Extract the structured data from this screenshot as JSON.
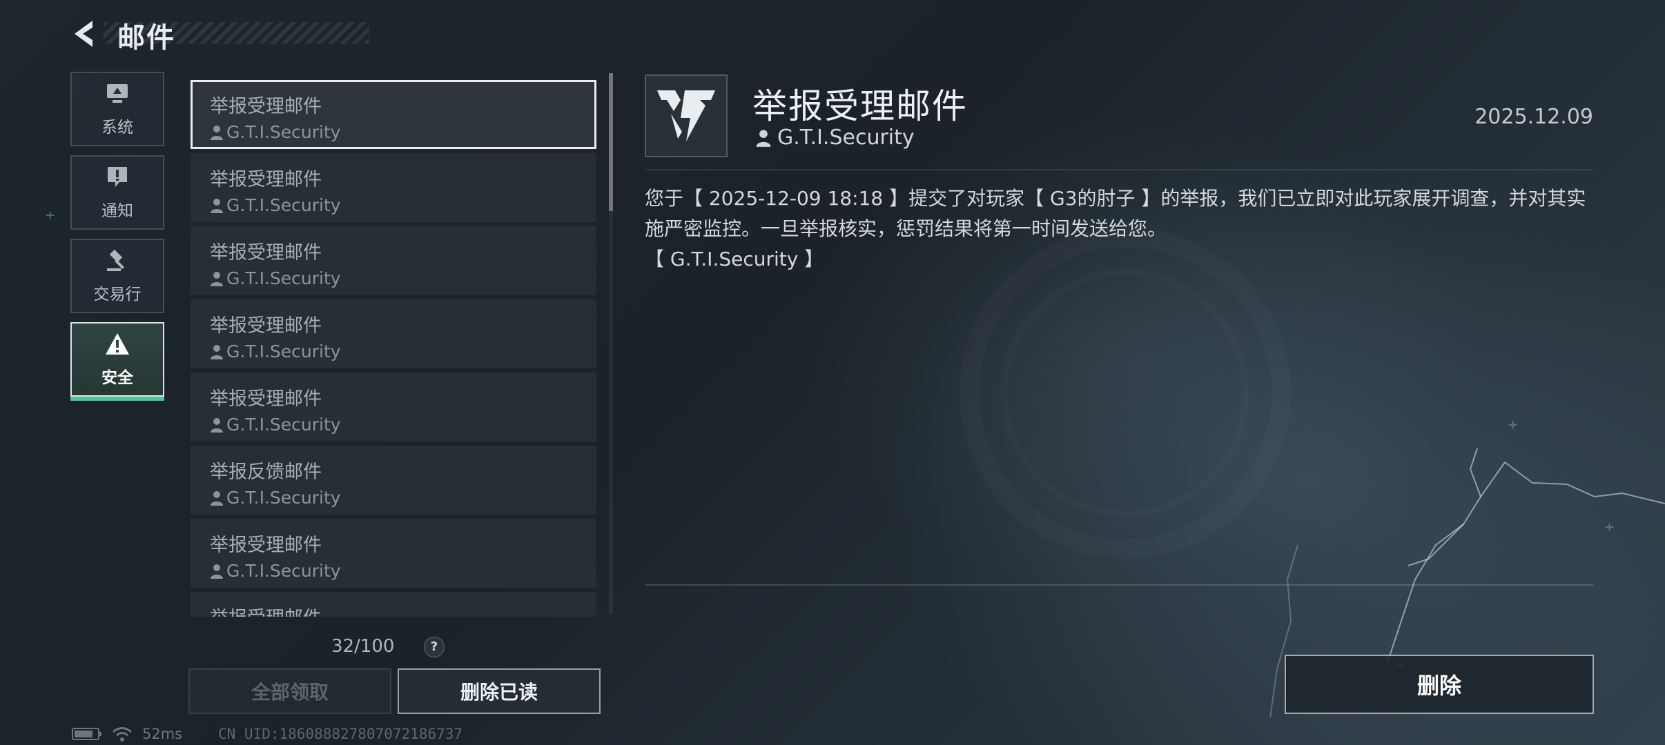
{
  "header": {
    "title": "邮件"
  },
  "categories": [
    {
      "label": "系统",
      "icon": "monitor-icon"
    },
    {
      "label": "通知",
      "icon": "exclamation-icon"
    },
    {
      "label": "交易行",
      "icon": "gavel-icon"
    },
    {
      "label": "安全",
      "icon": "warning-triangle-icon"
    }
  ],
  "active_category": "安全",
  "mails": [
    {
      "title": "举报受理邮件",
      "sender": "G.T.I.Security"
    },
    {
      "title": "举报受理邮件",
      "sender": "G.T.I.Security"
    },
    {
      "title": "举报受理邮件",
      "sender": "G.T.I.Security"
    },
    {
      "title": "举报受理邮件",
      "sender": "G.T.I.Security"
    },
    {
      "title": "举报受理邮件",
      "sender": "G.T.I.Security"
    },
    {
      "title": "举报反馈邮件",
      "sender": "G.T.I.Security"
    },
    {
      "title": "举报受理邮件",
      "sender": "G.T.I.Security"
    },
    {
      "title": "举报受理邮件",
      "sender": ""
    }
  ],
  "selected_mail_index": 0,
  "mail_count": "32/100",
  "help_label": "?",
  "buttons": {
    "collect_all": "全部领取",
    "delete_read": "删除已读",
    "delete": "删除"
  },
  "status": {
    "ping": "52ms",
    "uid": "CN UID:186088827807072186737"
  },
  "detail": {
    "title": "举报受理邮件",
    "sender": "G.T.I.Security",
    "date": "2025.12.09",
    "body_line1": "您于【 2025-12-09 18:18 】提交了对玩家【 G3的肘子 】的举报，我们已立即对此玩家展开调查，并对其实",
    "body_line2": "施严密监控。一旦举报核实，惩罚结果将第一时间发送给您。",
    "body_line3": "【 G.T.I.Security 】"
  },
  "colors": {
    "accent": "#4ec49b",
    "selected_border": "#e9edf0",
    "background": "#1d252d"
  }
}
